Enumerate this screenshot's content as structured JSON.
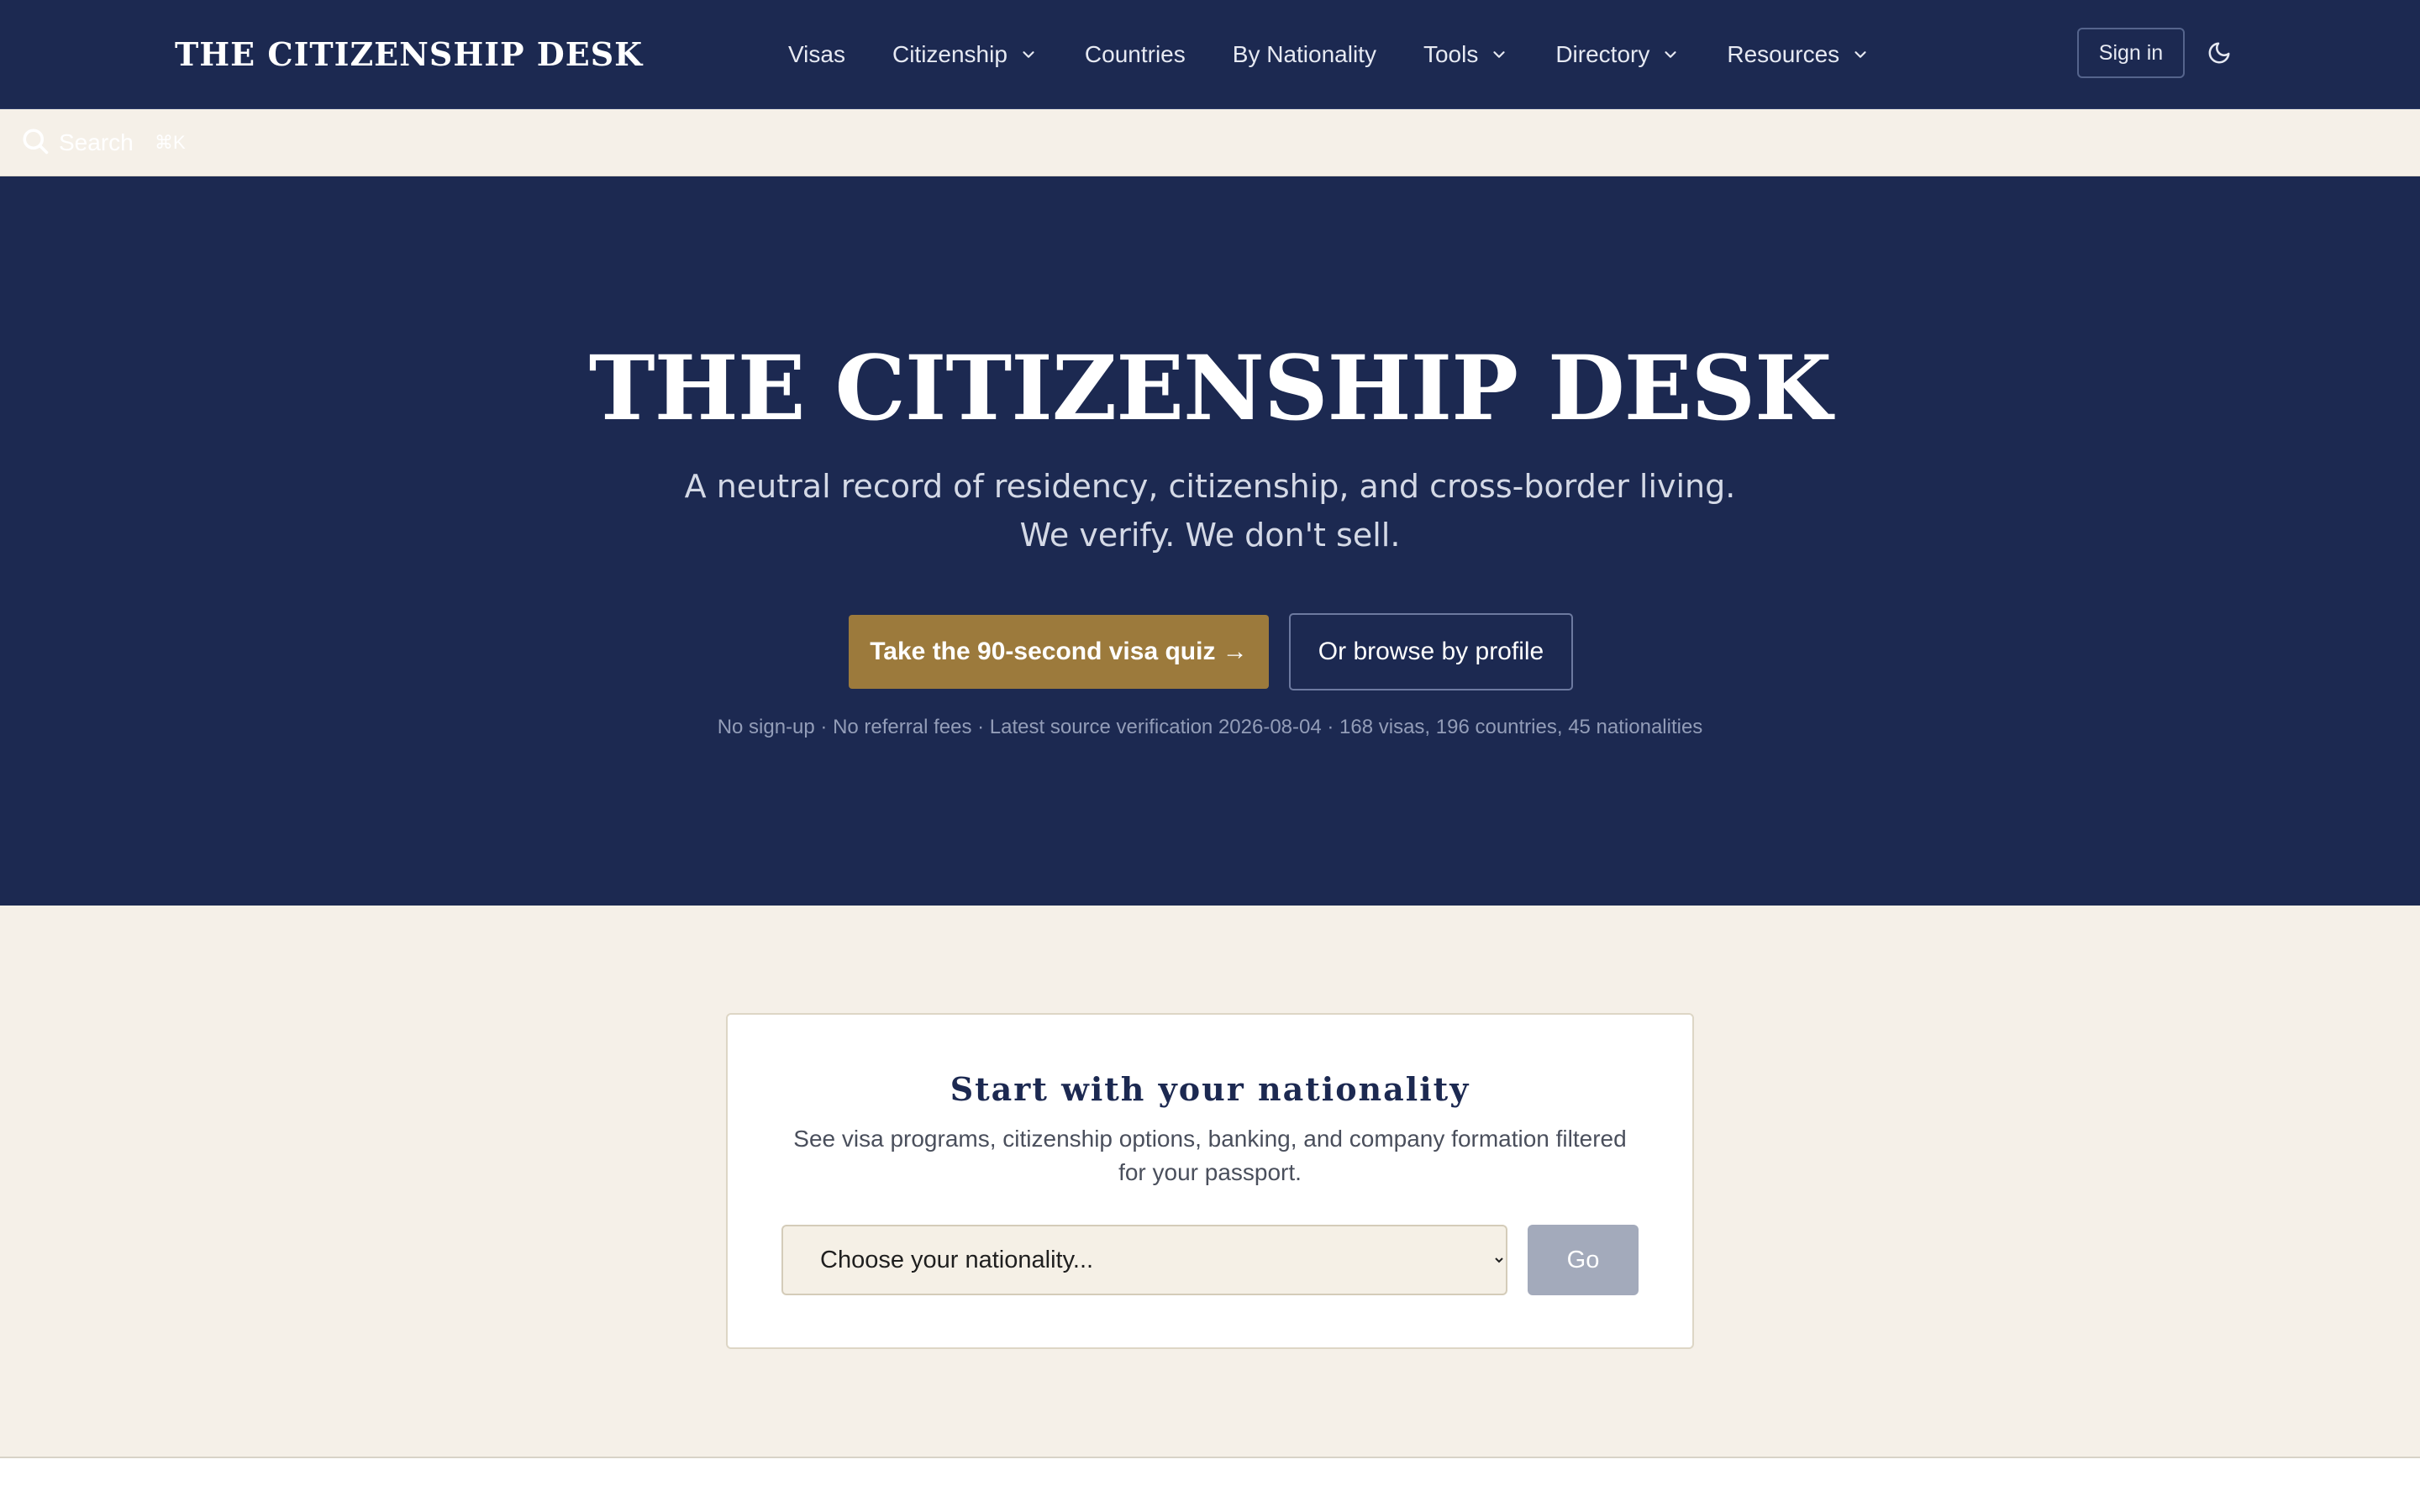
{
  "brand": {
    "name": "THE CITIZENSHIP DESK"
  },
  "nav": {
    "items": [
      {
        "label": "Visas",
        "dropdown": false
      },
      {
        "label": "Citizenship",
        "dropdown": true
      },
      {
        "label": "Countries",
        "dropdown": false
      },
      {
        "label": "By Nationality",
        "dropdown": false
      },
      {
        "label": "Tools",
        "dropdown": true
      },
      {
        "label": "Directory",
        "dropdown": true
      },
      {
        "label": "Resources",
        "dropdown": true
      }
    ],
    "signin_label": "Sign in",
    "theme_icon": "moon-icon"
  },
  "search": {
    "placeholder": "Search",
    "shortcut": "⌘K",
    "icon": "search-icon"
  },
  "hero": {
    "title": "THE CITIZENSHIP DESK",
    "subtitle": "A neutral record of residency, citizenship, and cross-border living. We verify. We don't sell.",
    "primary_cta": "Take the 90-second visa quiz →",
    "secondary_cta": "Or browse by profile",
    "meta": "No sign-up · No referral fees · Latest source verification 2026-08-04 · 168 visas, 196 countries, 45 nationalities"
  },
  "nationality_card": {
    "title": "Start with your nationality",
    "description": "See visa programs, citizenship options, banking, and company formation filtered for your passport.",
    "select_placeholder": "Choose your nationality...",
    "go_label": "Go"
  },
  "colors": {
    "navy": "#1c2951",
    "gold": "#9c7a3c",
    "cream": "#f5f0e8",
    "go_disabled": "#a3aabb"
  }
}
